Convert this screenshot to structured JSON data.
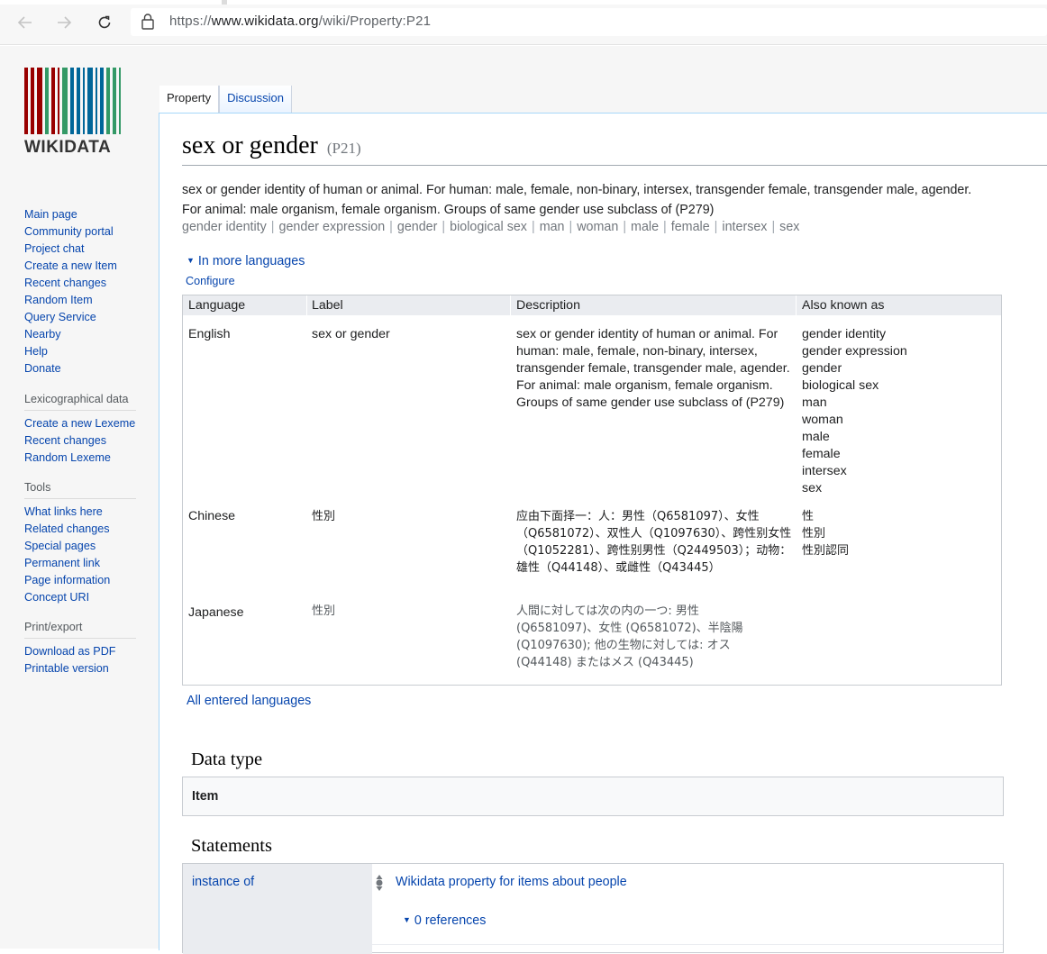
{
  "browser": {
    "url_prefix": "https://",
    "url_host": "www.wikidata.org",
    "url_path": "/wiki/Property:P21",
    "back_icon": "back-arrow-icon",
    "forward_icon": "forward-arrow-icon",
    "reload_icon": "reload-icon",
    "lock_icon": "lock-icon"
  },
  "logo": {
    "wordmark": "WIKIDATA"
  },
  "sidebar": {
    "nav": [
      "Main page",
      "Community portal",
      "Project chat",
      "Create a new Item",
      "Recent changes",
      "Random Item",
      "Query Service",
      "Nearby",
      "Help",
      "Donate"
    ],
    "lexicographical_heading": "Lexicographical data",
    "lexicographical": [
      "Create a new Lexeme",
      "Recent changes",
      "Random Lexeme"
    ],
    "tools_heading": "Tools",
    "tools": [
      "What links here",
      "Related changes",
      "Special pages",
      "Permanent link",
      "Page information",
      "Concept URI"
    ],
    "print_heading": "Print/export",
    "print": [
      "Download as PDF",
      "Printable version"
    ]
  },
  "tabs": {
    "property": "Property",
    "discussion": "Discussion"
  },
  "entity": {
    "label": "sex or gender",
    "id": "(P21)",
    "description": "sex or gender identity of human or animal. For human: male, female, non-binary, intersex, transgender female, transgender male, agender. For animal: male organism, female organism. Groups of same gender use subclass of (P279)",
    "aliases": [
      "gender identity",
      "gender expression",
      "gender",
      "biological sex",
      "man",
      "woman",
      "male",
      "female",
      "intersex",
      "sex"
    ]
  },
  "languages": {
    "toggle": "In more languages",
    "configure": "Configure",
    "headers": {
      "language": "Language",
      "label": "Label",
      "description": "Description",
      "aliases": "Also known as"
    },
    "rows": [
      {
        "language": "English",
        "label": "sex or gender",
        "description": "sex or gender identity of human or animal. For human: male, female, non-binary, intersex, transgender female, transgender male, agender. For animal: male organism, female organism. Groups of same gender use subclass of (P279)",
        "aliases": [
          "gender identity",
          "gender expression",
          "gender",
          "biological sex",
          "man",
          "woman",
          "male",
          "female",
          "intersex",
          "sex"
        ]
      },
      {
        "language": "Chinese",
        "label": "性別",
        "description": "应由下面择一：人：男性（Q6581097）、女性（Q6581072）、双性人（Q1097630）、跨性别女性（Q1052281）、跨性别男性（Q2449503）；动物：雄性（Q44148）、或雌性（Q43445）",
        "aliases": [
          "性",
          "性別",
          "性別認同"
        ]
      },
      {
        "language": "Japanese",
        "label": "性別",
        "description": "人間に対しては次の内の一つ: 男性 (Q6581097)、女性 (Q6581072)、半陰陽 (Q1097630); 他の生物に対しては: オス (Q44148) またはメス (Q43445)",
        "aliases": []
      }
    ],
    "all_entered": "All entered languages"
  },
  "datatype": {
    "heading": "Data type",
    "value": "Item"
  },
  "statements": {
    "heading": "Statements",
    "property": "instance of",
    "value": "Wikidata property for items about people",
    "references": "0 references",
    "rank_icon": "normal-rank-icon"
  },
  "colors": {
    "link": "#0645ad",
    "logo_red": "#990000",
    "logo_green": "#339966",
    "logo_blue": "#006699"
  }
}
